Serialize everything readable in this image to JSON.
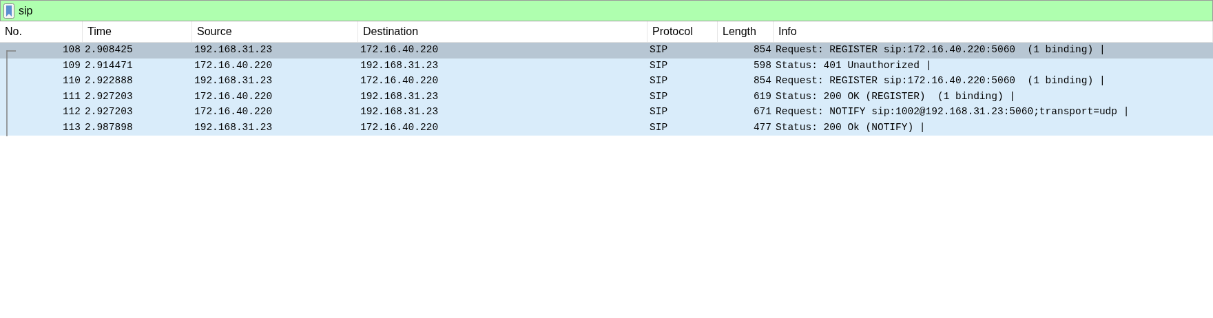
{
  "filter": {
    "value": "sip"
  },
  "table": {
    "columns": [
      "No.",
      "Time",
      "Source",
      "Destination",
      "Protocol",
      "Length",
      "Info"
    ],
    "rows": [
      {
        "no": "108",
        "time": "2.908425",
        "source": "192.168.31.23",
        "destination": "172.16.40.220",
        "protocol": "SIP",
        "length": "854",
        "info": "Request: REGISTER sip:172.16.40.220:5060  (1 binding) |",
        "selected": true
      },
      {
        "no": "109",
        "time": "2.914471",
        "source": "172.16.40.220",
        "destination": "192.168.31.23",
        "protocol": "SIP",
        "length": "598",
        "info": "Status: 401 Unauthorized |",
        "selected": false
      },
      {
        "no": "110",
        "time": "2.922888",
        "source": "192.168.31.23",
        "destination": "172.16.40.220",
        "protocol": "SIP",
        "length": "854",
        "info": "Request: REGISTER sip:172.16.40.220:5060  (1 binding) |",
        "selected": false
      },
      {
        "no": "111",
        "time": "2.927203",
        "source": "172.16.40.220",
        "destination": "192.168.31.23",
        "protocol": "SIP",
        "length": "619",
        "info": "Status: 200 OK (REGISTER)  (1 binding) |",
        "selected": false
      },
      {
        "no": "112",
        "time": "2.927203",
        "source": "172.16.40.220",
        "destination": "192.168.31.23",
        "protocol": "SIP",
        "length": "671",
        "info": "Request: NOTIFY sip:1002@192.168.31.23:5060;transport=udp |",
        "selected": false
      },
      {
        "no": "113",
        "time": "2.987898",
        "source": "192.168.31.23",
        "destination": "172.16.40.220",
        "protocol": "SIP",
        "length": "477",
        "info": "Status: 200 Ok (NOTIFY) |",
        "selected": false
      }
    ]
  }
}
